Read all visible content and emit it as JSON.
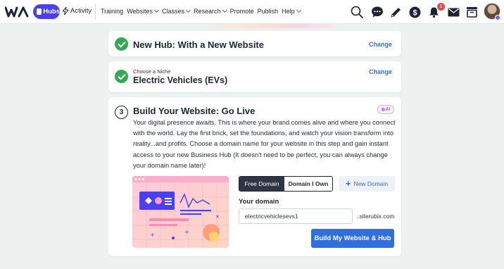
{
  "nav": {
    "hubs_label": "Hubs",
    "activity_label": "Activity",
    "menu": [
      {
        "label": "Training",
        "has_caret": false
      },
      {
        "label": "Websites",
        "has_caret": true
      },
      {
        "label": "Classes",
        "has_caret": true
      },
      {
        "label": "Research",
        "has_caret": true
      },
      {
        "label": "Promote",
        "has_caret": false
      },
      {
        "label": "Publish",
        "has_caret": false
      },
      {
        "label": "Help",
        "has_caret": true
      }
    ],
    "notification_count": "1",
    "icons": [
      "search-icon",
      "chat-icon",
      "pencil-icon",
      "dollar-icon",
      "bell-icon",
      "mail-icon",
      "inbox-icon"
    ]
  },
  "step1": {
    "title": "New Hub: With a New Website",
    "change_label": "Change"
  },
  "step2": {
    "subtitle": "Choose a Niche",
    "title": "Electric Vehicles (EVs)",
    "change_label": "Change"
  },
  "step3": {
    "number": "3",
    "title": "Build Your Website: Go Live",
    "ai_label": "AI",
    "description": "Your digital presence awaits. This is where your brand comes alive and where you connect with the world. Lay the first brick, set the foundations, and watch your vision transform into reality...and profits. Choose a domain name for your website in this step and gain instant access to your new Business Hub (It doesn't need to be perfect, you can always change your domain name later)!",
    "tabs": {
      "free": "Free Domain",
      "own": "Domain I Own"
    },
    "new_domain_label": "New Domain",
    "your_domain_label": "Your domain",
    "domain_value": "electricvehiclesevs1",
    "domain_suffix": ".siterubix.com",
    "build_button": "Build My Website & Hub"
  },
  "colors": {
    "brand": "#4a3ff2",
    "accent_blue": "#2f6fe0",
    "success": "#34a853",
    "background": "#edf2f1"
  }
}
